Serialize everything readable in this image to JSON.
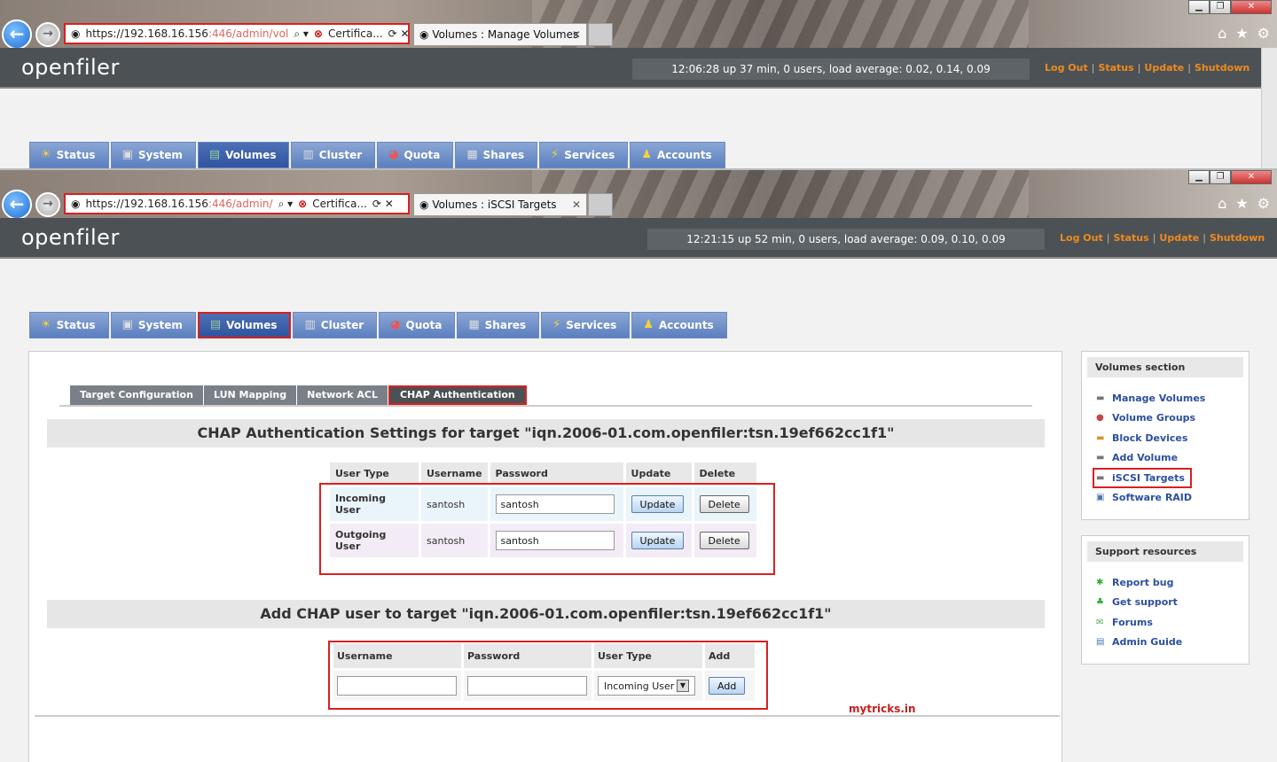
{
  "windows": [
    {
      "address": {
        "host": "https://192.168.16.156",
        "path": ":446/admin/vol",
        "cert": "Certifica..."
      },
      "tab_title": "Volumes : Manage Volumes",
      "uptime": "12:06:28 up 37 min, 0 users, load average: 0.02, 0.14, 0.09"
    },
    {
      "address": {
        "host": "https://192.168.16.156",
        "path": ":446/admin/",
        "cert": "Certifica..."
      },
      "tab_title": "Volumes : iSCSI Targets",
      "uptime": "12:21:15 up 52 min, 0 users, load average: 0.09, 0.10, 0.09"
    }
  ],
  "brand": "openfiler",
  "top_links": [
    "Log Out",
    "Status",
    "Update",
    "Shutdown"
  ],
  "main_nav": [
    {
      "label": "Status",
      "icon": "sun-icon"
    },
    {
      "label": "System",
      "icon": "monitor-icon"
    },
    {
      "label": "Volumes",
      "icon": "disk-icon"
    },
    {
      "label": "Cluster",
      "icon": "cluster-icon"
    },
    {
      "label": "Quota",
      "icon": "pie-icon"
    },
    {
      "label": "Shares",
      "icon": "folder-icon"
    },
    {
      "label": "Services",
      "icon": "lightning-icon"
    },
    {
      "label": "Accounts",
      "icon": "users-icon"
    }
  ],
  "sub_tabs": [
    "Target Configuration",
    "LUN Mapping",
    "Network ACL",
    "CHAP Authentication"
  ],
  "chap_section": {
    "title": "CHAP Authentication Settings for target \"iqn.2006-01.com.openfiler:tsn.19ef662cc1f1\"",
    "headers": [
      "User Type",
      "Username",
      "Password",
      "Update",
      "Delete"
    ],
    "rows": [
      {
        "type": "Incoming User",
        "username": "santosh",
        "password": "santosh",
        "update": "Update",
        "delete": "Delete"
      },
      {
        "type": "Outgoing User",
        "username": "santosh",
        "password": "santosh",
        "update": "Update",
        "delete": "Delete"
      }
    ]
  },
  "add_section": {
    "title": "Add CHAP user to target \"iqn.2006-01.com.openfiler:tsn.19ef662cc1f1\"",
    "headers": [
      "Username",
      "Password",
      "User Type",
      "Add"
    ],
    "user_type_selected": "Incoming User",
    "add_label": "Add"
  },
  "volumes_section": {
    "title": "Volumes section",
    "items": [
      "Manage Volumes",
      "Volume Groups",
      "Block Devices",
      "Add Volume",
      "iSCSI Targets",
      "Software RAID"
    ]
  },
  "support_section": {
    "title": "Support resources",
    "items": [
      "Report bug",
      "Get support",
      "Forums",
      "Admin Guide"
    ]
  },
  "credit": "mytricks.in",
  "colors": {
    "accent_orange": "#f08a1e",
    "nav_blue": "#5b7fbf",
    "link_blue": "#2b4fa0",
    "highlight_red": "#d82020"
  }
}
